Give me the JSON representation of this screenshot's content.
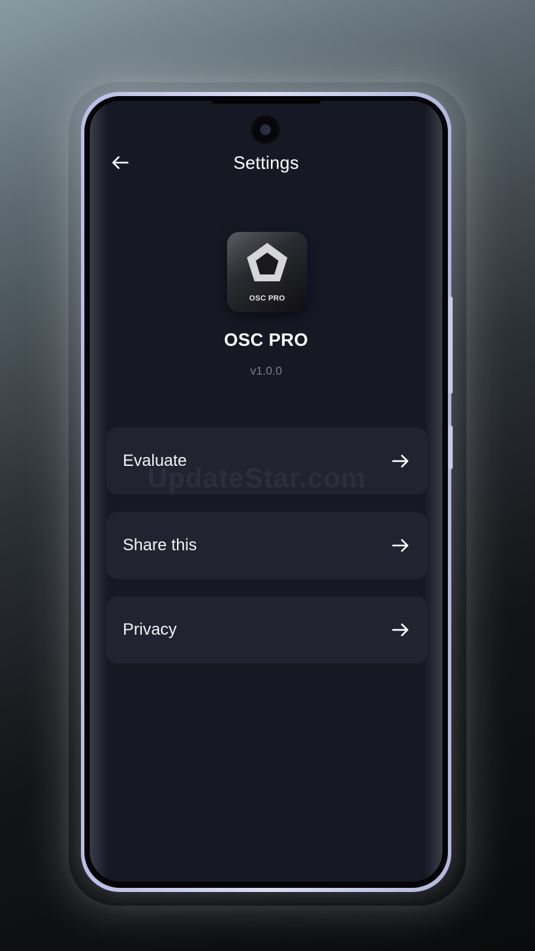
{
  "header": {
    "title": "Settings",
    "back_icon": "arrow-left-icon"
  },
  "app": {
    "icon_label": "OSC PRO",
    "name": "OSC PRO",
    "version": "v1.0.0",
    "icon_shape": "pentagon-icon"
  },
  "menu": {
    "items": [
      {
        "label": "Evaluate",
        "icon": "arrow-right-icon"
      },
      {
        "label": "Share this",
        "icon": "arrow-right-icon"
      },
      {
        "label": "Privacy",
        "icon": "arrow-right-icon"
      }
    ]
  },
  "watermark": "UpdateStar.com",
  "colors": {
    "screen_background": "#161824",
    "card_background": "#212331",
    "text_primary": "#ffffff",
    "text_secondary": "#7b7f8a",
    "frame": "#c7cae8"
  }
}
